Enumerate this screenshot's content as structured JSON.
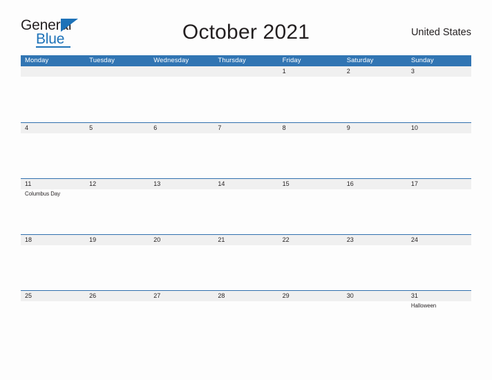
{
  "brand": {
    "name_part1": "General",
    "name_part2": "Blue",
    "accent_color": "#1d72b8"
  },
  "header": {
    "title": "October 2021",
    "country": "United States"
  },
  "theme": {
    "header_blue": "#3175b3",
    "row_band_gray": "#f0f0f0",
    "row_rule_blue": "#2f6fad",
    "text_color": "#231f20"
  },
  "calendar": {
    "weekday_headers": [
      "Monday",
      "Tuesday",
      "Wednesday",
      "Thursday",
      "Friday",
      "Saturday",
      "Sunday"
    ],
    "weeks": [
      {
        "days": [
          {
            "num": "",
            "event": ""
          },
          {
            "num": "",
            "event": ""
          },
          {
            "num": "",
            "event": ""
          },
          {
            "num": "",
            "event": ""
          },
          {
            "num": "1",
            "event": ""
          },
          {
            "num": "2",
            "event": ""
          },
          {
            "num": "3",
            "event": ""
          }
        ]
      },
      {
        "days": [
          {
            "num": "4",
            "event": ""
          },
          {
            "num": "5",
            "event": ""
          },
          {
            "num": "6",
            "event": ""
          },
          {
            "num": "7",
            "event": ""
          },
          {
            "num": "8",
            "event": ""
          },
          {
            "num": "9",
            "event": ""
          },
          {
            "num": "10",
            "event": ""
          }
        ]
      },
      {
        "days": [
          {
            "num": "11",
            "event": "Columbus Day"
          },
          {
            "num": "12",
            "event": ""
          },
          {
            "num": "13",
            "event": ""
          },
          {
            "num": "14",
            "event": ""
          },
          {
            "num": "15",
            "event": ""
          },
          {
            "num": "16",
            "event": ""
          },
          {
            "num": "17",
            "event": ""
          }
        ]
      },
      {
        "days": [
          {
            "num": "18",
            "event": ""
          },
          {
            "num": "19",
            "event": ""
          },
          {
            "num": "20",
            "event": ""
          },
          {
            "num": "21",
            "event": ""
          },
          {
            "num": "22",
            "event": ""
          },
          {
            "num": "23",
            "event": ""
          },
          {
            "num": "24",
            "event": ""
          }
        ]
      },
      {
        "days": [
          {
            "num": "25",
            "event": ""
          },
          {
            "num": "26",
            "event": ""
          },
          {
            "num": "27",
            "event": ""
          },
          {
            "num": "28",
            "event": ""
          },
          {
            "num": "29",
            "event": ""
          },
          {
            "num": "30",
            "event": ""
          },
          {
            "num": "31",
            "event": "Halloween"
          }
        ]
      }
    ]
  }
}
